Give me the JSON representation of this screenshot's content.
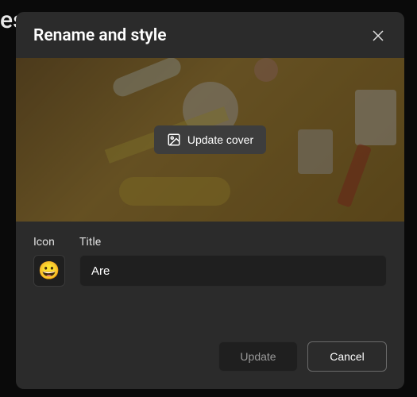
{
  "background": {
    "partial_text": "es"
  },
  "modal": {
    "title": "Rename and style",
    "cover": {
      "update_label": "Update cover"
    },
    "form": {
      "icon_label": "Icon",
      "icon_value": "😀",
      "title_label": "Title",
      "title_value": "Are"
    },
    "footer": {
      "update_label": "Update",
      "cancel_label": "Cancel"
    }
  }
}
